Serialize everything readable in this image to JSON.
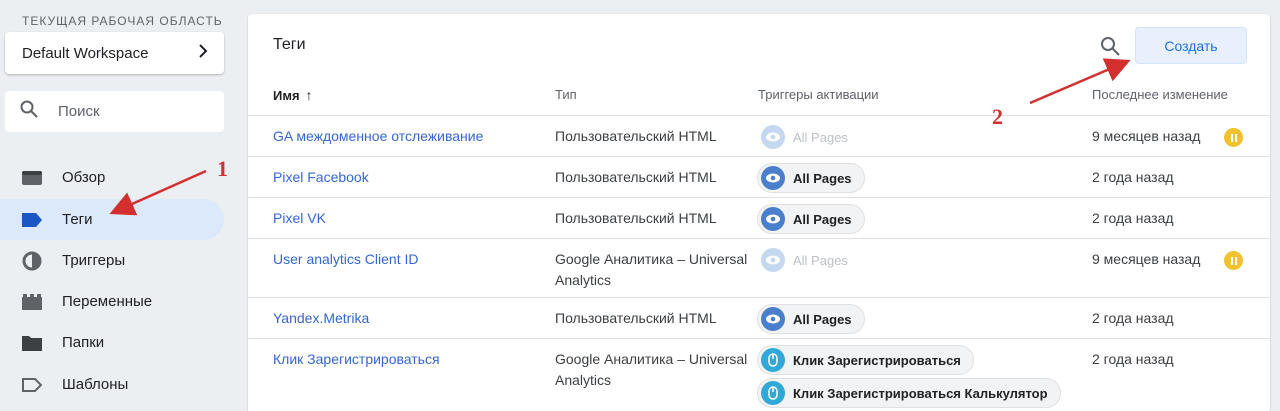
{
  "sidebar": {
    "workspace_label": "ТЕКУЩАЯ РАБОЧАЯ ОБЛАСТЬ",
    "workspace_name": "Default Workspace",
    "search_placeholder": "Поиск",
    "items": [
      {
        "label": "Обзор",
        "icon": "overview-icon"
      },
      {
        "label": "Теги",
        "icon": "tag-icon",
        "active": true
      },
      {
        "label": "Триггеры",
        "icon": "trigger-icon"
      },
      {
        "label": "Переменные",
        "icon": "variables-icon"
      },
      {
        "label": "Папки",
        "icon": "folder-icon"
      },
      {
        "label": "Шаблоны",
        "icon": "template-icon"
      }
    ]
  },
  "main": {
    "title": "Теги",
    "create_label": "Создать",
    "columns": {
      "name": "Имя",
      "type": "Тип",
      "triggers": "Триггеры активации",
      "modified": "Последнее изменение"
    },
    "rows": [
      {
        "name": "GA междоменное отслеживание",
        "type": "Пользовательский HTML",
        "triggers": [
          {
            "label": "All Pages",
            "disabled": true
          }
        ],
        "modified": "9 месяцев назад",
        "paused": true
      },
      {
        "name": "Pixel Facebook",
        "type": "Пользовательский HTML",
        "triggers": [
          {
            "label": "All Pages"
          }
        ],
        "modified": "2 года назад"
      },
      {
        "name": "Pixel VK",
        "type": "Пользовательский HTML",
        "triggers": [
          {
            "label": "All Pages"
          }
        ],
        "modified": "2 года назад"
      },
      {
        "name": "User analytics Client ID",
        "type": "Google Аналитика – Universal Analytics",
        "triggers": [
          {
            "label": "All Pages",
            "disabled": true
          }
        ],
        "modified": "9 месяцев назад",
        "paused": true
      },
      {
        "name": "Yandex.Metrika",
        "type": "Пользовательский HTML",
        "triggers": [
          {
            "label": "All Pages"
          }
        ],
        "modified": "2 года назад"
      },
      {
        "name": "Клик Зарегистрироваться",
        "type": "Google Аналитика – Universal Analytics",
        "triggers": [
          {
            "label": "Клик Зарегистрироваться",
            "kind": "click"
          },
          {
            "label": "Клик Зарегистрироваться Калькулятор",
            "kind": "click"
          }
        ],
        "modified": "2 года назад"
      }
    ]
  },
  "annotations": {
    "one": "1",
    "two": "2",
    "color": "#d32f2f"
  }
}
